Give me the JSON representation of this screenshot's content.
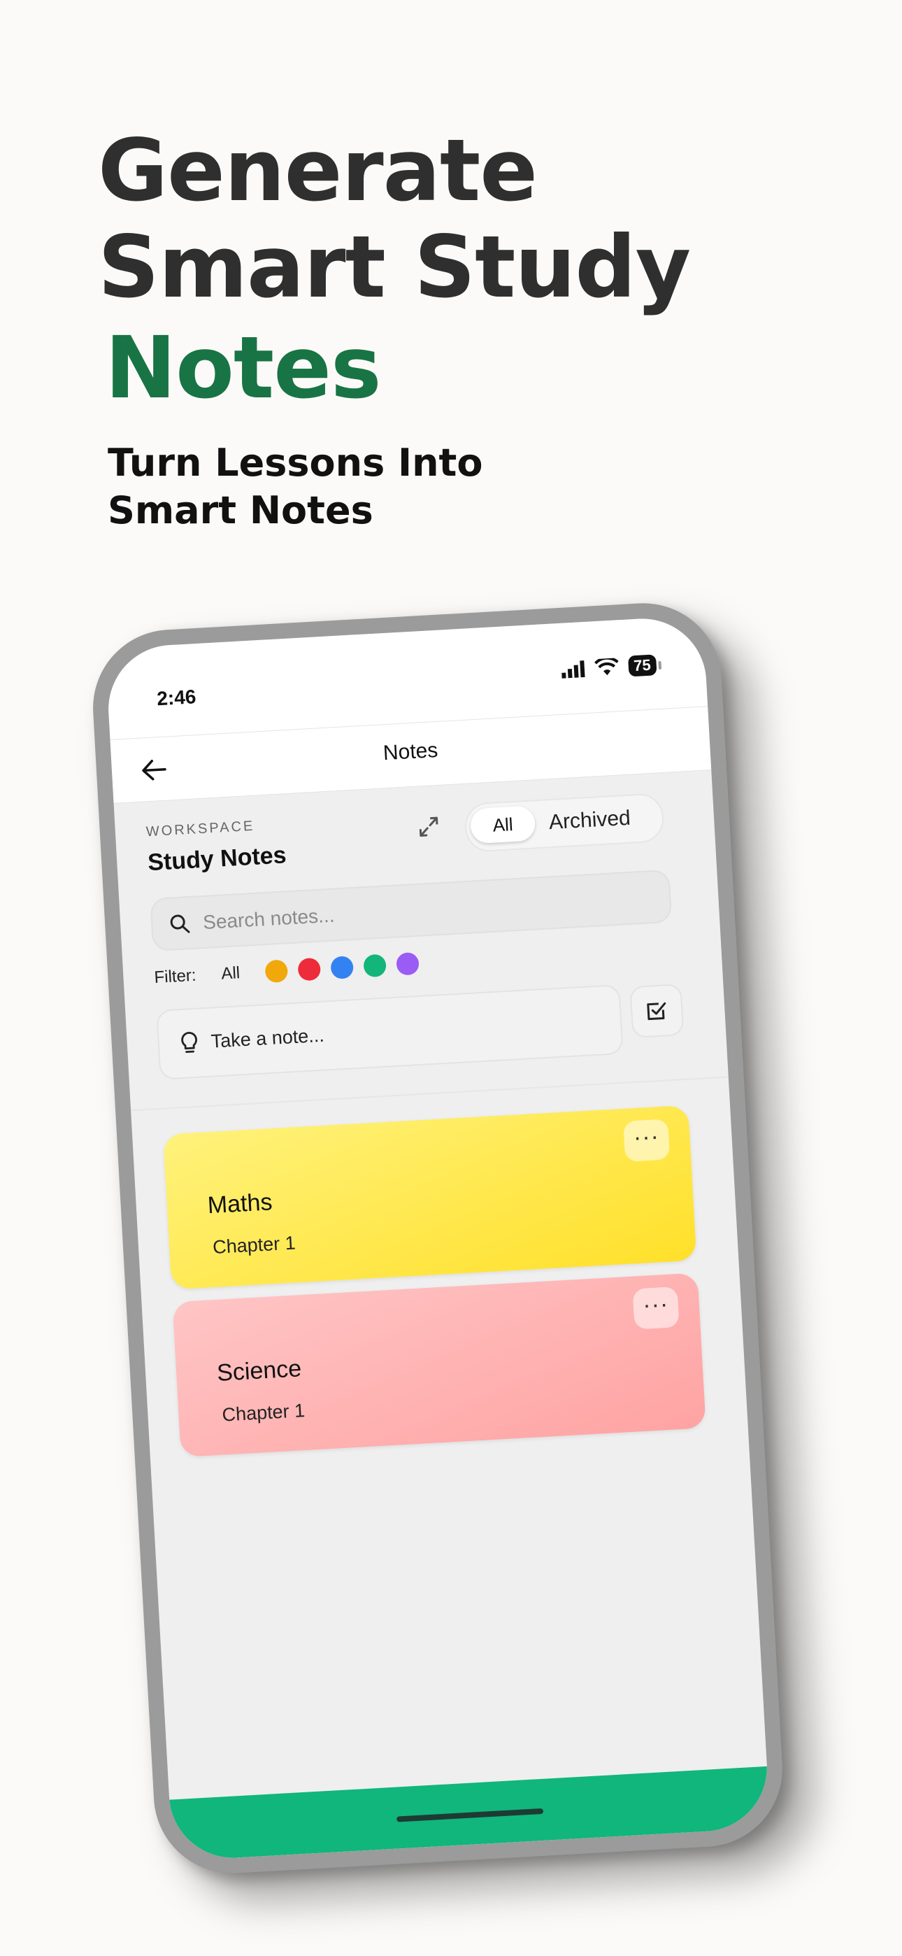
{
  "hero": {
    "line1": "Generate",
    "line2": "Smart Study",
    "line3": "Notes",
    "sub1": "Turn Lessons Into",
    "sub2": "Smart Notes"
  },
  "status_bar": {
    "time": "2:46",
    "battery": "75"
  },
  "nav": {
    "title": "Notes"
  },
  "workspace": {
    "label": "WORKSPACE",
    "title": "Study Notes"
  },
  "segment": {
    "all": "All",
    "archived": "Archived",
    "selected": "All"
  },
  "search": {
    "placeholder": "Search notes..."
  },
  "filter": {
    "label": "Filter:",
    "all": "All",
    "colors": [
      "#f0a80a",
      "#ee2b3a",
      "#3382f2",
      "#13b57a",
      "#9a5cf5"
    ]
  },
  "take_note": {
    "placeholder": "Take a note..."
  },
  "notes": [
    {
      "title": "Maths",
      "subtitle": "Chapter 1",
      "color": "#ffe84a"
    },
    {
      "title": "Science",
      "subtitle": "Chapter 1",
      "color": "#ffb3b3"
    }
  ],
  "colors": {
    "accent_green": "#187444",
    "bottom_bar": "#10b67c"
  }
}
